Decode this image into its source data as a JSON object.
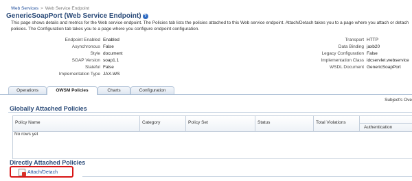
{
  "breadcrumb": {
    "parent": "Web Services",
    "separator": ">",
    "current": "Web Service Endpoint"
  },
  "page": {
    "title": "GenericSoapPort (Web Service Endpoint)",
    "description": "This page shows details and metrics for the Web service endpoint. The Policies tab lists the policies attached to this Web service endpoint. Attach/Detach takes you to a page where you attach or detach policies. The Configuration tab takes you to a page where you configure endpoint configuration."
  },
  "properties_left": [
    {
      "label": "Endpoint Enabled",
      "value": "Enabled"
    },
    {
      "label": "Asynchronous",
      "value": "False"
    },
    {
      "label": "Style",
      "value": "document"
    },
    {
      "label": "SOAP Version",
      "value": "soap1.1"
    },
    {
      "label": "Stateful",
      "value": "False"
    },
    {
      "label": "Implementation Type",
      "value": "JAX-WS"
    }
  ],
  "properties_right": [
    {
      "label": "Transport",
      "value": "HTTP"
    },
    {
      "label": "Data Binding",
      "value": "jaxb20"
    },
    {
      "label": "Legacy Configuration",
      "value": "False"
    },
    {
      "label": "Implementation Class",
      "value": "idcservlet.webservice"
    },
    {
      "label": "WSDL Document",
      "value": "GenericSoapPort"
    }
  ],
  "tabs": [
    {
      "label": "Operations"
    },
    {
      "label": "OWSM Policies"
    },
    {
      "label": "Charts"
    },
    {
      "label": "Configuration"
    }
  ],
  "subjects_label": "Subject's Ove",
  "globally": {
    "title": "Globally Attached Policies",
    "columns": {
      "policy_name": "Policy Name",
      "category": "Category",
      "policy_set": "Policy Set",
      "status": "Status",
      "total_violations": "Total Violations",
      "authentication": "Authentication"
    },
    "empty_text": "No rows yet"
  },
  "directly": {
    "title": "Directly Attached Policies",
    "attach_detach_label": "Attach/Detach"
  }
}
